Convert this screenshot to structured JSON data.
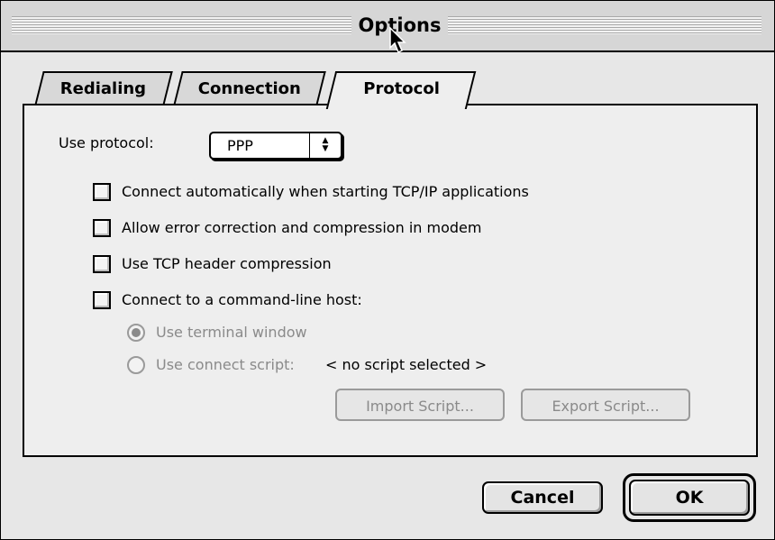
{
  "window": {
    "title": "Options"
  },
  "tabs": [
    {
      "label": "Redialing"
    },
    {
      "label": "Connection"
    },
    {
      "label": "Protocol"
    }
  ],
  "protocol": {
    "label": "Use protocol:",
    "selected": "PPP"
  },
  "checkboxes": [
    {
      "label": "Connect automatically when starting TCP/IP applications",
      "checked": false
    },
    {
      "label": "Allow error correction and compression in modem",
      "checked": false
    },
    {
      "label": "Use TCP header compression",
      "checked": false
    },
    {
      "label": "Connect to a command-line host:",
      "checked": false
    }
  ],
  "radios": [
    {
      "label": "Use terminal window",
      "selected": true
    },
    {
      "label": "Use connect script:",
      "selected": false
    }
  ],
  "script": {
    "status": "< no script selected >"
  },
  "buttons": {
    "import": "Import Script...",
    "export": "Export Script...",
    "cancel": "Cancel",
    "ok": "OK"
  },
  "colors": {
    "window_bg": "#e7e7e7",
    "panel_bg": "#eeeeee",
    "disabled_text": "#8a8a8a"
  }
}
